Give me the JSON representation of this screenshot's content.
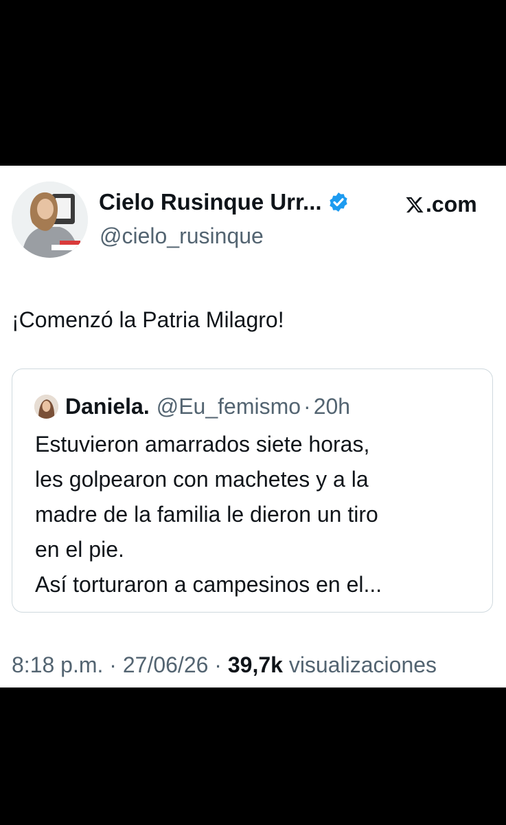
{
  "author": {
    "name": "Cielo Rusinque Urr...",
    "handle": "@cielo_rusinque",
    "verified": true
  },
  "brand": {
    "label": ".com",
    "icon": "x-logo-icon"
  },
  "tweet": {
    "text": "¡Comenzó la Patria Milagro!"
  },
  "quoted": {
    "name": "Daniela.",
    "handle": "@Eu_femismo",
    "separator": "·",
    "time": "20h",
    "lines": [
      "Estuvieron amarrados siete horas,",
      "les golpearon con machetes y a la",
      "madre de la familia le dieron un tiro",
      "en el pie.",
      "Así torturaron a campesinos en el..."
    ]
  },
  "meta": {
    "time": "8:18 p.m.",
    "separator": "·",
    "date": "27/06/26",
    "views_count": "39,7k",
    "views_label": "visualizaciones"
  },
  "colors": {
    "verified_badge": "#1d9bf0",
    "text_primary": "#0f1419",
    "text_secondary": "#536471",
    "border": "#cfd9de",
    "letterbox": "#000000"
  }
}
